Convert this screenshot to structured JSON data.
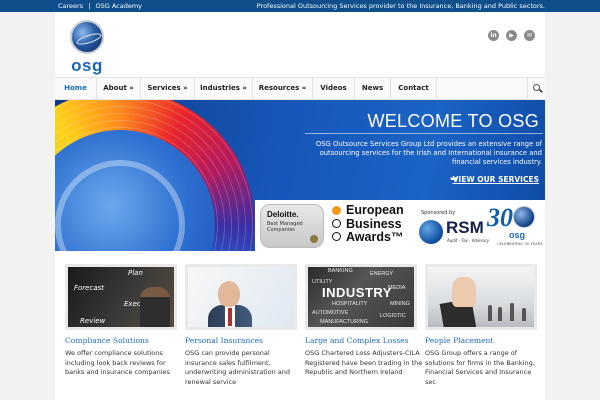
{
  "topbar": {
    "links": [
      "Careers",
      "|",
      "OSG Academy"
    ],
    "tagline": "Professional Outsourcing Services provider to the Insurance, Banking and Public sectors."
  },
  "logo": {
    "word": "osg"
  },
  "social": [
    {
      "icon": "linkedin-icon",
      "glyph": "in"
    },
    {
      "icon": "youtube-icon",
      "glyph": "▶"
    },
    {
      "icon": "email-icon",
      "glyph": "✉"
    }
  ],
  "nav": {
    "items": [
      "Home",
      "About »",
      "Services »",
      "Industries »",
      "Resources »",
      "Videos",
      "News",
      "Contact"
    ],
    "active": "Home"
  },
  "hero": {
    "title": "WELCOME TO OSG",
    "description": "OSG Outsource Services Group Ltd provides an extensive range of outsourcing services for the Irish and International insurance and financial services industry.",
    "cta": "VIEW OUR SERVICES"
  },
  "award": {
    "deloitte_name": "Deloitte.",
    "deloitte_label": "Best Managed Companies",
    "eba_lines": [
      "European",
      "Business",
      "Awards™"
    ],
    "sponsor_label": "Sponsored by",
    "rsm_name": "RSM",
    "rsm_sub": "Audit · Tax · Advisory",
    "osg30_number": "30",
    "osg30_word": "osg",
    "osg30_caption": "CELEBRATING 30 YEARS"
  },
  "cards": [
    {
      "title": "Compliance Solutions",
      "description": "We offer compliance solutions including look back reviews for banks and insurance companies",
      "thumb_words": [
        "Plan",
        "Forecast",
        "Execute",
        "Review"
      ]
    },
    {
      "title": "Personal Insurances",
      "description": "OSG can provide personal insurance sales fulfilment, underwriting administration and renewal service"
    },
    {
      "title": "Large and Complex Losses",
      "description": "OSG Chartered Loss Adjusters-CILA Registered have been trading in the Republic and Northern Ireland",
      "thumb_words": [
        "BANKING",
        "ENERGY",
        "UTILITY",
        "INDUSTRY",
        "MEDIA",
        "HOSPITALITY",
        "MINING",
        "AUTOMOTIVE",
        "LOGISTIC",
        "MANUFACTURING"
      ]
    },
    {
      "title": "People Placement",
      "description": "OSG Group offers a range of solutions for firms in the Banking, Financial Services and Insurance sec"
    }
  ],
  "colors": {
    "topbar": "#0e4e8a",
    "accent": "#1d6cc0",
    "hero": "#1657b8"
  }
}
